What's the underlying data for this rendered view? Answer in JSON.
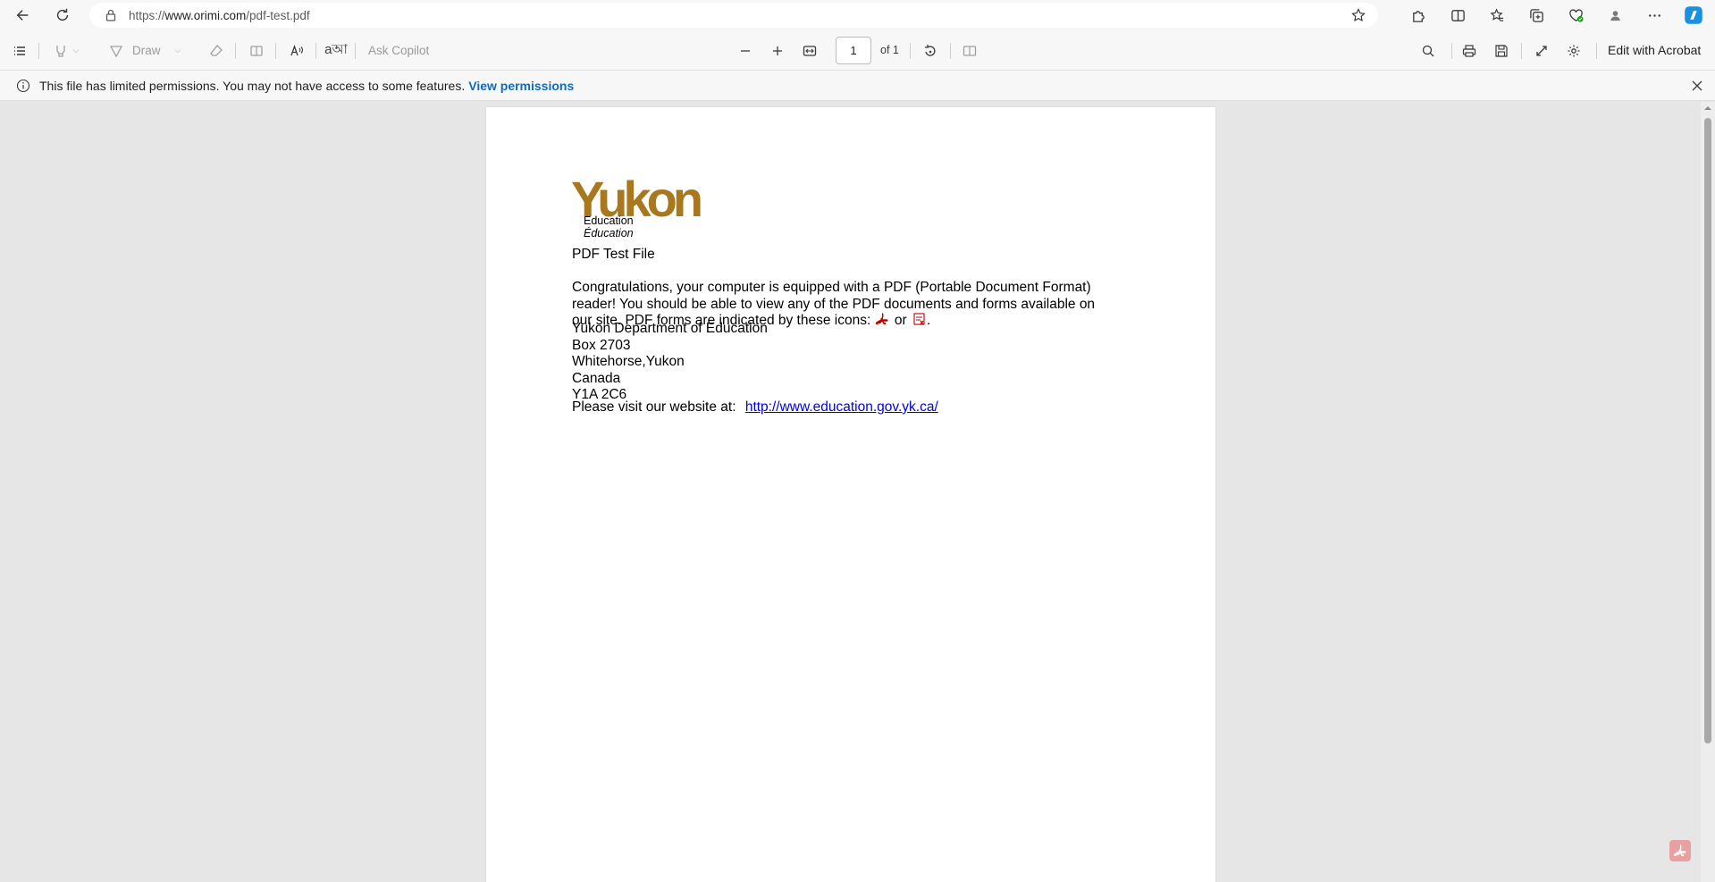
{
  "browser": {
    "url_prefix": "https://",
    "url_host": "www.orimi.com",
    "url_path": "/pdf-test.pdf"
  },
  "toolbar": {
    "draw_label": "Draw",
    "ask_copilot_label": "Ask Copilot",
    "current_page": "1",
    "page_of": "of 1",
    "edit_acrobat_label": "Edit with Acrobat"
  },
  "infobar": {
    "message": "This file has limited permissions. You may not have access to some features.",
    "link_label": "View permissions"
  },
  "document": {
    "logo": {
      "brand": "Yukon",
      "line1": "Education",
      "line2": "Éducation"
    },
    "title": "PDF Test File",
    "para_line1": "Congratulations, your computer is equipped with a PDF (Portable Document Format)",
    "para_line2": "reader!  You should be able to view any of the PDF documents and forms available on",
    "para_line3_a": "our site.  PDF forms are indicated by these icons:",
    "para_line3_b": "or",
    "para_line3_c": ".",
    "address": [
      "Yukon Department of Education",
      "Box 2703",
      "Whitehorse,Yukon",
      "Canada",
      "Y1A 2C6"
    ],
    "visit_text": "Please visit our website at:",
    "website_link": "http://www.education.gov.yk.ca/"
  },
  "colors": {
    "logo_gold": "#a8781e",
    "link_blue": "#0f6cbd",
    "doc_link_blue": "#0000ee",
    "pdf_red": "#c00000"
  },
  "icons": {
    "back": "back-arrow-icon",
    "refresh": "refresh-icon",
    "lock": "lock-icon",
    "favorite": "star-icon",
    "extensions": "puzzle-icon",
    "split": "split-screen-icon",
    "favorites": "favorites-icon",
    "collections": "collections-icon",
    "health": "browser-essentials-icon",
    "profile": "profile-icon",
    "more": "more-icon",
    "copilot": "copilot-icon"
  }
}
